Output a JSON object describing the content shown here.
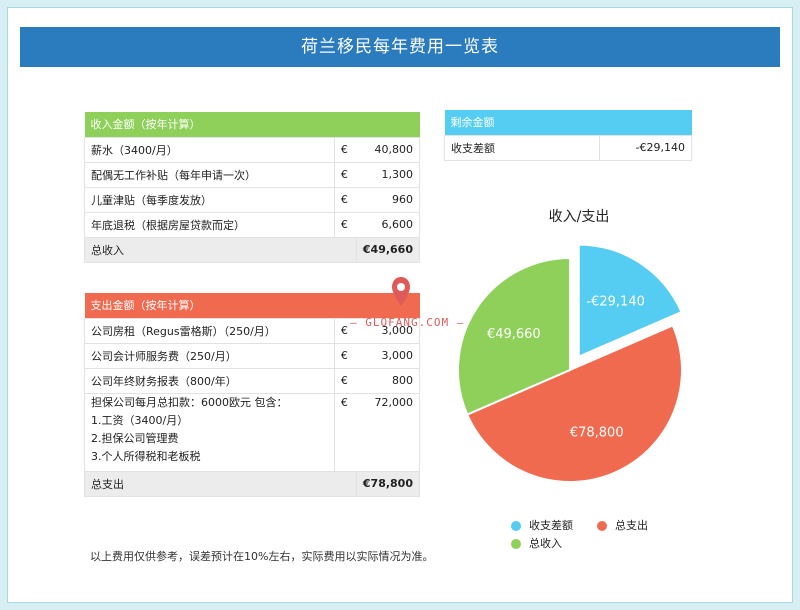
{
  "title": "荷兰移民每年费用一览表",
  "income": {
    "header": "收入金额（按年计算）",
    "rows": [
      {
        "label": "薪水（3400/月）",
        "currency": "€",
        "amount": "40,800"
      },
      {
        "label": "配偶无工作补贴（每年申请一次）",
        "currency": "€",
        "amount": "1,300"
      },
      {
        "label": "儿童津贴（每季度发放）",
        "currency": "€",
        "amount": "960"
      },
      {
        "label": "年底退税（根据房屋贷款而定）",
        "currency": "€",
        "amount": "6,600"
      }
    ],
    "total_label": "总收入",
    "total_value": "€49,660"
  },
  "expense": {
    "header": "支出金额（按年计算）",
    "rows": [
      {
        "label": "公司房租（Regus雷格斯）（250/月）",
        "currency": "€",
        "amount": "3,000"
      },
      {
        "label": "公司会计师服务费（250/月）",
        "currency": "€",
        "amount": "3,000"
      },
      {
        "label": "公司年终财务报表（800/年）",
        "currency": "€",
        "amount": "800"
      }
    ],
    "multi_row": {
      "lines": [
        "担保公司每月总扣款：6000欧元 包含：",
        "1.工资（3400/月）",
        "2.担保公司管理费",
        "3.个人所得税和老板税"
      ],
      "currency": "€",
      "amount": "72,000"
    },
    "total_label": "总支出",
    "total_value": "€78,800"
  },
  "balance": {
    "header": "剩余金额",
    "label": "收支差额",
    "value": "-€29,140"
  },
  "chart_data": {
    "type": "pie",
    "title": "收入/支出",
    "slices": [
      {
        "name": "收支差额",
        "value": -29140,
        "display": "-€29,140",
        "color": "#55ccf2",
        "exploded": true
      },
      {
        "name": "总支出",
        "value": 78800,
        "display": "€78,800",
        "color": "#f06a50",
        "exploded": false
      },
      {
        "name": "总收入",
        "value": 49660,
        "display": "€49,660",
        "color": "#8ed05a",
        "exploded": false
      }
    ],
    "legend": [
      "收支差额",
      "总支出",
      "总收入"
    ],
    "legend_placement": "bottom"
  },
  "note": "以上费用仅供参考，误差预计在10%左右，实际费用以实际情况为准。",
  "watermark": {
    "text": "— GLOFANG.COM —",
    "logo": "map-pin-logo"
  }
}
